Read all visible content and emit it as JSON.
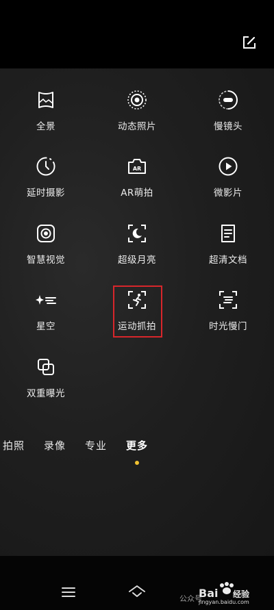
{
  "modes": [
    {
      "id": "panorama",
      "label": "全景",
      "icon": "panorama-icon"
    },
    {
      "id": "live-photo",
      "label": "动态照片",
      "icon": "live-photo-icon"
    },
    {
      "id": "slow-motion",
      "label": "慢镜头",
      "icon": "slow-motion-icon"
    },
    {
      "id": "time-lapse",
      "label": "延时摄影",
      "icon": "time-lapse-icon"
    },
    {
      "id": "ar-cute",
      "label": "AR萌拍",
      "icon": "ar-camera-icon"
    },
    {
      "id": "micro-film",
      "label": "微影片",
      "icon": "play-icon"
    },
    {
      "id": "smart-vision",
      "label": "智慧视觉",
      "icon": "smart-vision-icon"
    },
    {
      "id": "super-moon",
      "label": "超级月亮",
      "icon": "moon-icon"
    },
    {
      "id": "doc-scan",
      "label": "超清文档",
      "icon": "document-icon"
    },
    {
      "id": "starry-sky",
      "label": "星空",
      "icon": "star-icon"
    },
    {
      "id": "sport-snap",
      "label": "运动抓拍",
      "icon": "running-figure-icon"
    },
    {
      "id": "time-shutter",
      "label": "时光慢门",
      "icon": "slow-shutter-icon"
    },
    {
      "id": "double-exposure",
      "label": "双重曝光",
      "icon": "double-exposure-icon"
    }
  ],
  "tabs": [
    {
      "label": "拍照",
      "active": false
    },
    {
      "label": "录像",
      "active": false
    },
    {
      "label": "专业",
      "active": false
    },
    {
      "label": "更多",
      "active": true
    }
  ],
  "watermark": {
    "text": "公众号",
    "logo": "Baidu经验",
    "url": "jingyan.baidu.com"
  },
  "colors": {
    "highlight": "#d9262b",
    "indicator": "#f1c232",
    "background": "#1f1f1f"
  }
}
